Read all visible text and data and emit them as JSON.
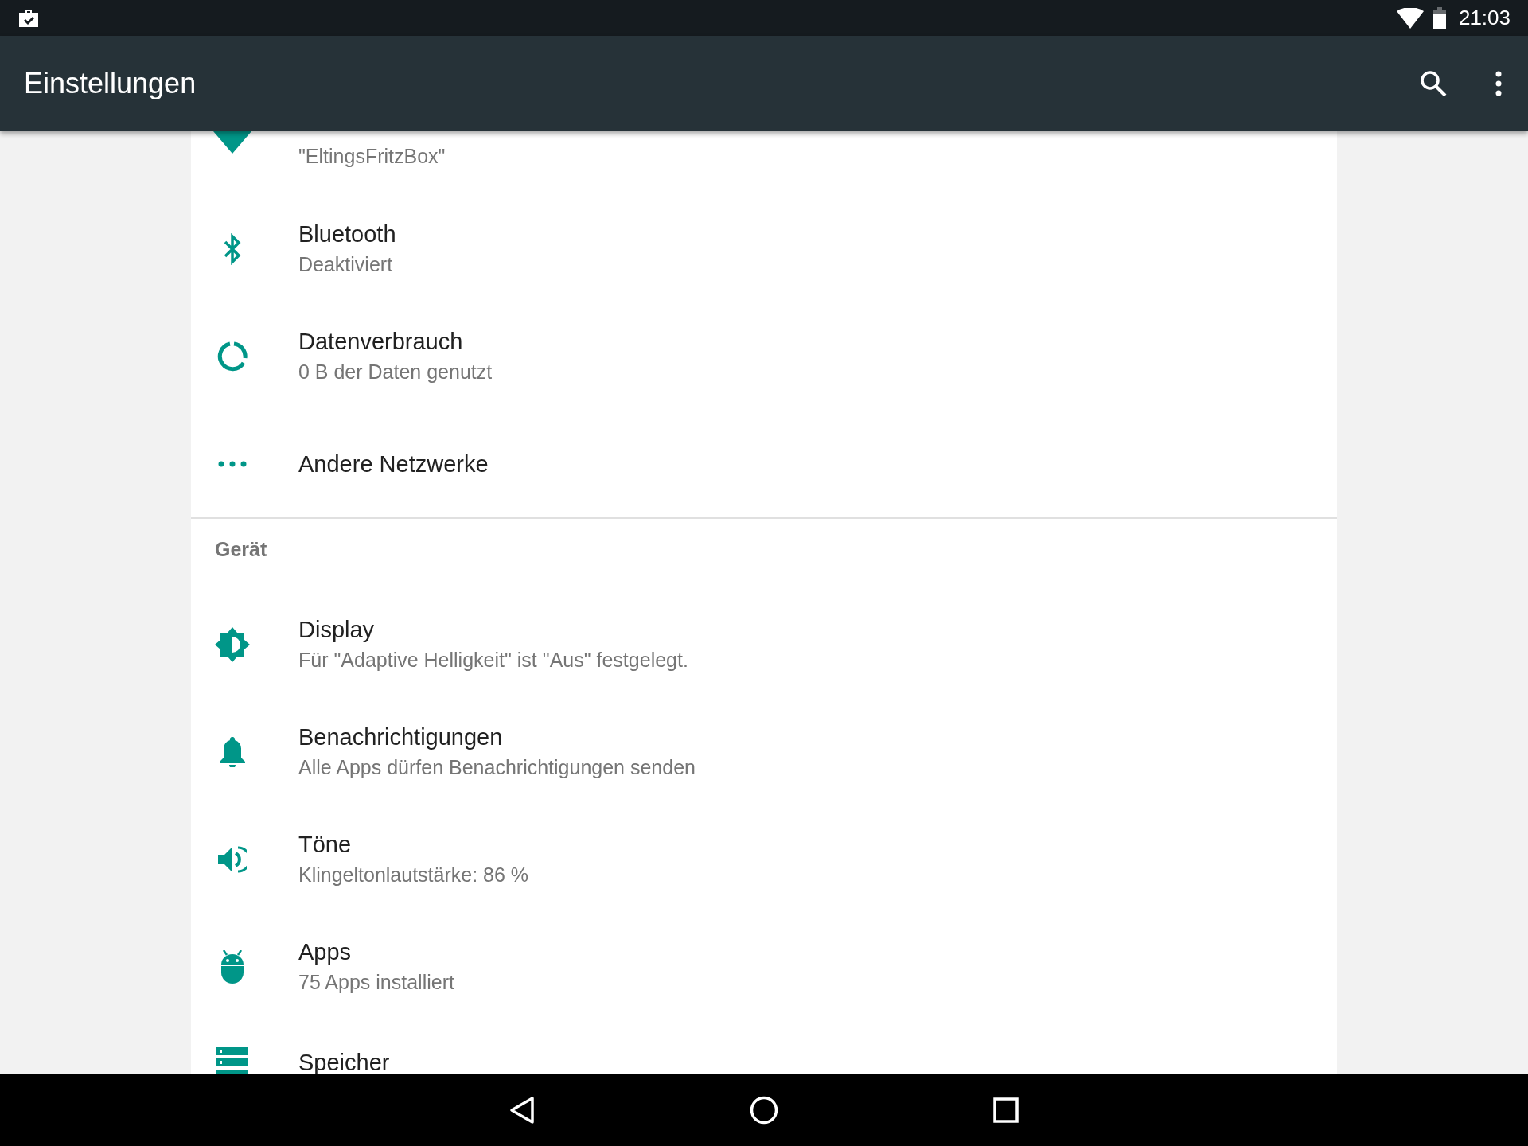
{
  "status_bar": {
    "time": "21:03"
  },
  "app_bar": {
    "title": "Einstellungen"
  },
  "sections": [
    {
      "items": [
        {
          "kind": "wifi",
          "subtitle": "\"EltingsFritzBox\""
        },
        {
          "kind": "bluetooth",
          "title": "Bluetooth",
          "subtitle": "Deaktiviert"
        },
        {
          "kind": "data",
          "title": "Datenverbrauch",
          "subtitle": "0 B der Daten genutzt"
        },
        {
          "kind": "more",
          "title": "Andere Netzwerke"
        }
      ]
    },
    {
      "title": "Gerät",
      "items": [
        {
          "kind": "display",
          "title": "Display",
          "subtitle": "Für \"Adaptive Helligkeit\" ist \"Aus\" festgelegt."
        },
        {
          "kind": "bell",
          "title": "Benachrichtigungen",
          "subtitle": "Alle Apps dürfen Benachrichtigungen senden"
        },
        {
          "kind": "sound",
          "title": "Töne",
          "subtitle": "Klingeltonlautstärke: 86 %"
        },
        {
          "kind": "android",
          "title": "Apps",
          "subtitle": "75 Apps installiert"
        },
        {
          "kind": "storage",
          "title": "Speicher"
        }
      ]
    }
  ]
}
